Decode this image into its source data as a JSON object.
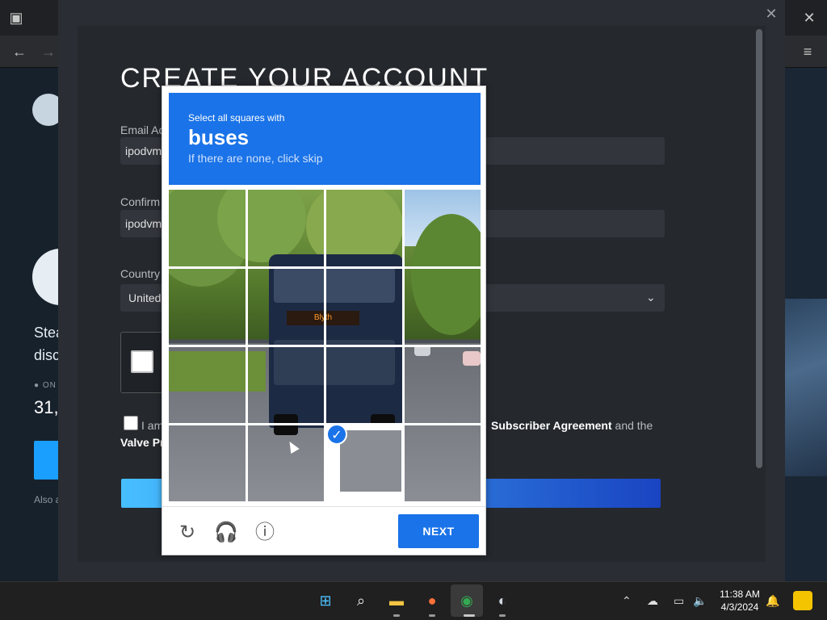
{
  "modal": {
    "title": "CREATE YOUR ACCOUNT",
    "email_label": "Email Ac",
    "email_value": "ipodvm",
    "confirm_label": "Confirm",
    "confirm_value": "ipodvm",
    "country_label": "Country",
    "country_value": "United",
    "agree_prefix": "I am",
    "agree_link": "Subscriber Agreement",
    "agree_suffix": " and the",
    "valve_link": "Valve Pr"
  },
  "background": {
    "steam_text_1": "Stea",
    "steam_text_2": "disc",
    "online_label": "ON",
    "online_count": "31,",
    "also": "Also a"
  },
  "recaptcha": {
    "prompt": "Select all squares with",
    "target": "buses",
    "subtext": "If there are none, click skip",
    "bus_sign": "Blyth",
    "next_label": "NEXT",
    "reload_icon": "refresh-icon",
    "audio_icon": "headphones-icon",
    "info_icon": "info-icon"
  },
  "taskbar": {
    "time": "11:38 AM",
    "date": "4/3/2024"
  },
  "colors": {
    "recaptcha_blue": "#1a73e8",
    "steam_bg": "#1b2838"
  }
}
